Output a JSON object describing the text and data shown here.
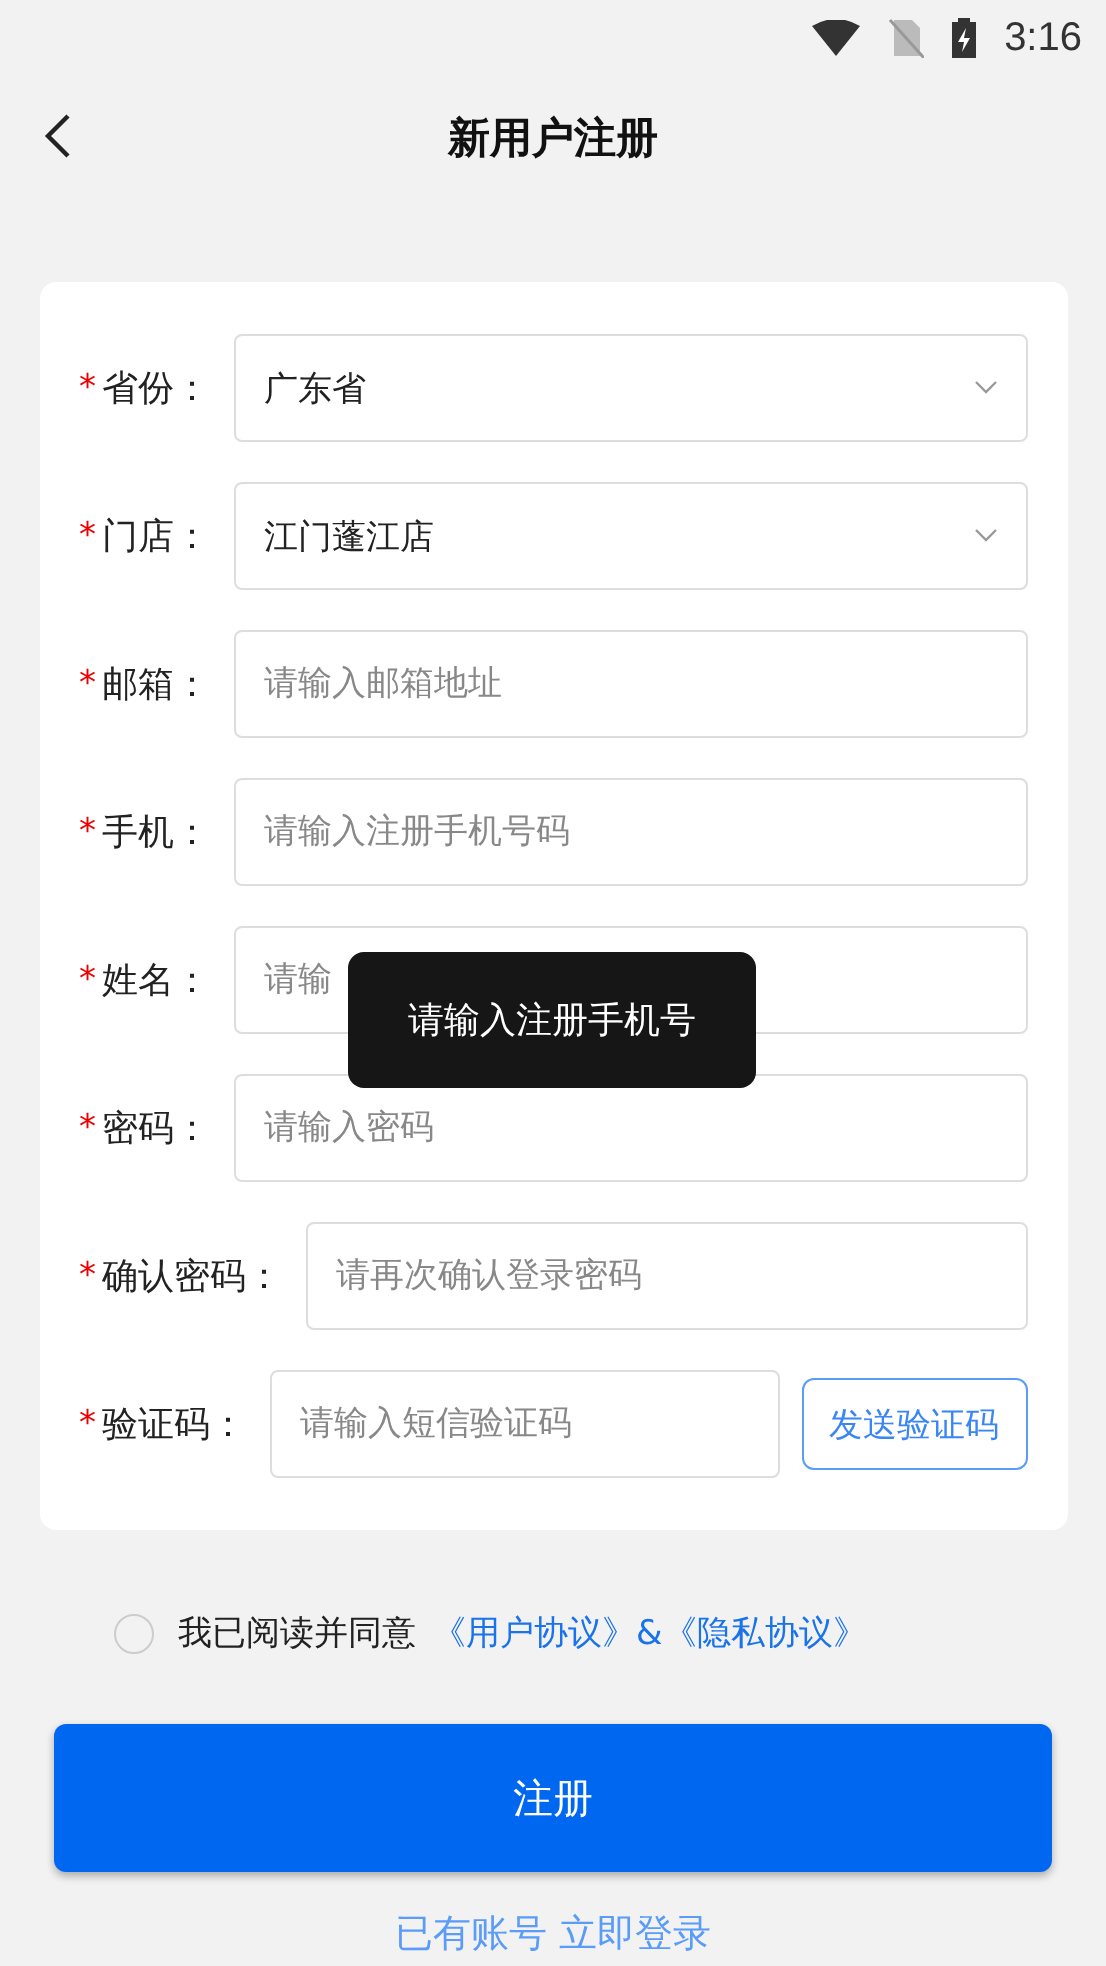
{
  "status_bar": {
    "time": "3:16"
  },
  "nav": {
    "title": "新用户注册"
  },
  "form": [
    {
      "kind": "select",
      "required_mark": "*",
      "label": "省份：",
      "value": "广东省"
    },
    {
      "kind": "select",
      "required_mark": "*",
      "label": "门店：",
      "value": "江门蓬江店"
    },
    {
      "kind": "input",
      "required_mark": "*",
      "label": "邮箱：",
      "placeholder": "请输入邮箱地址"
    },
    {
      "kind": "input",
      "required_mark": "*",
      "label": "手机：",
      "placeholder": "请输入注册手机号码"
    },
    {
      "kind": "input",
      "required_mark": "*",
      "label": "姓名：",
      "placeholder": "请输"
    },
    {
      "kind": "input",
      "required_mark": "*",
      "label": "密码：",
      "placeholder": "请输入密码"
    },
    {
      "kind": "input",
      "required_mark": "*",
      "label": "确认密码：",
      "placeholder": "请再次确认登录密码"
    },
    {
      "kind": "code",
      "required_mark": "*",
      "label": "验证码：",
      "placeholder": "请输入短信验证码",
      "button": "发送验证码"
    }
  ],
  "agreement": {
    "checked": false,
    "text": "我已阅读并同意",
    "links": [
      "《用户协议》",
      "&《隐私协议》"
    ]
  },
  "submit": "注册",
  "login_link": "已有账号 立即登录",
  "toast": "请输入注册手机号"
}
